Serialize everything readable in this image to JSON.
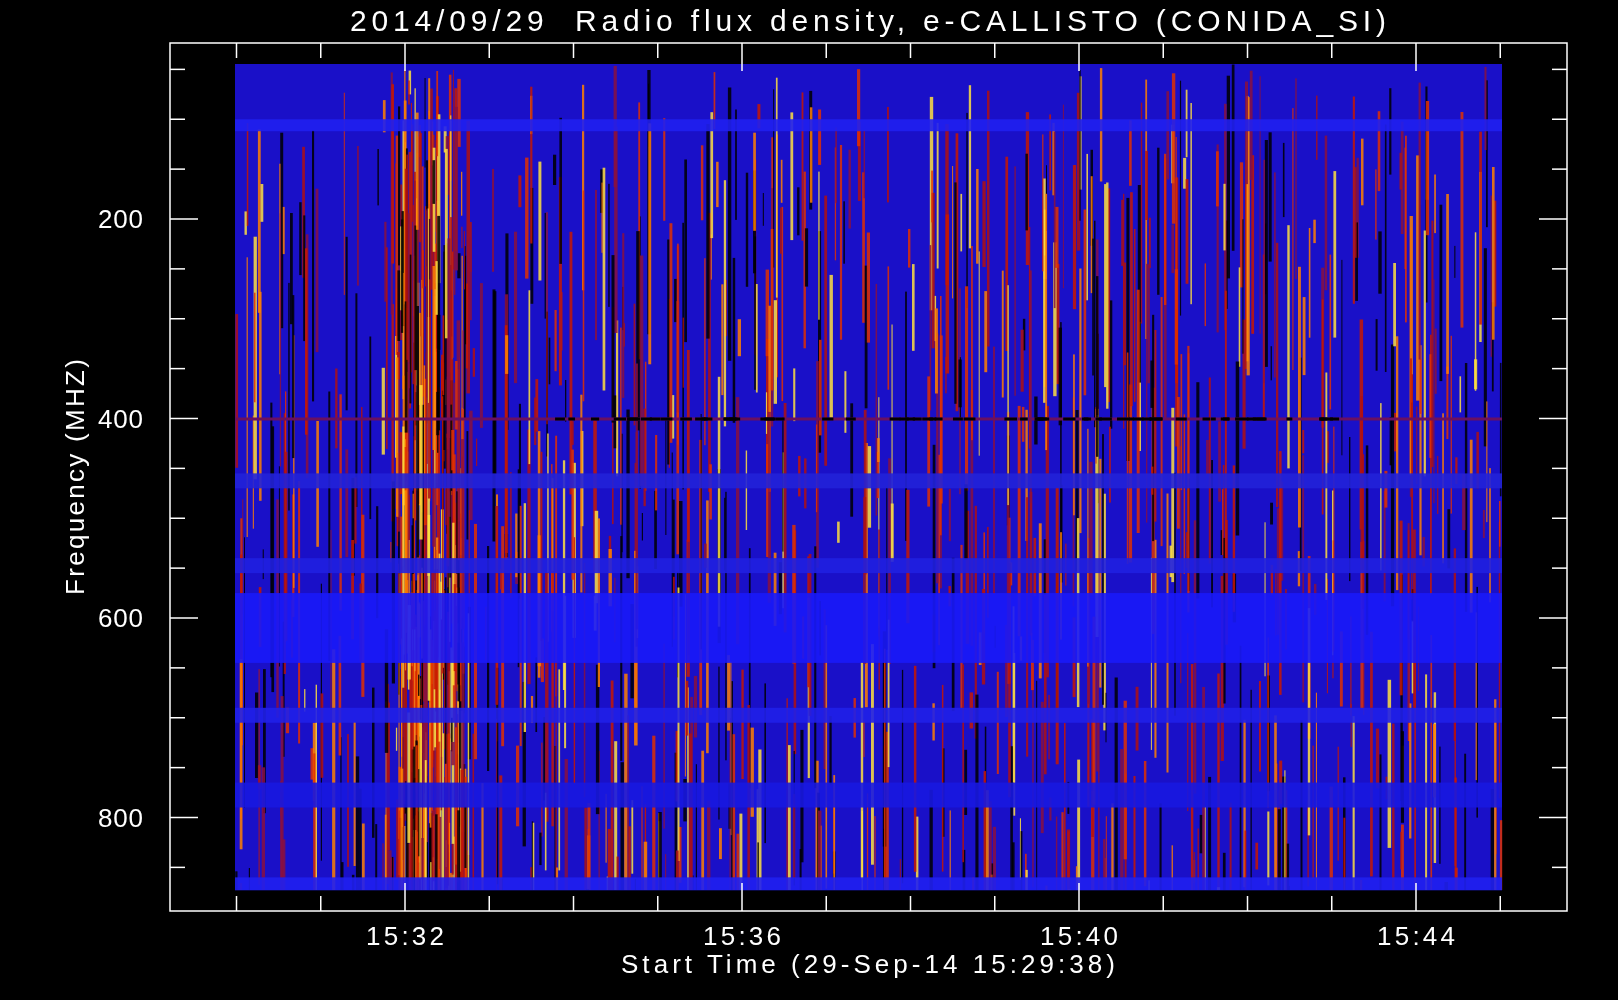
{
  "chart": {
    "title": "2014/09/29  Radio flux density, e-CALLISTO (CONIDA_SI)",
    "y_axis": {
      "label": "Frequency (MHZ)",
      "ticks": [
        "200",
        "400",
        "600",
        "800"
      ]
    },
    "x_axis": {
      "label": "Start Time (29-Sep-14 15:29:38)",
      "ticks": [
        "15:32",
        "15:36",
        "15:40",
        "15:44"
      ]
    }
  }
}
